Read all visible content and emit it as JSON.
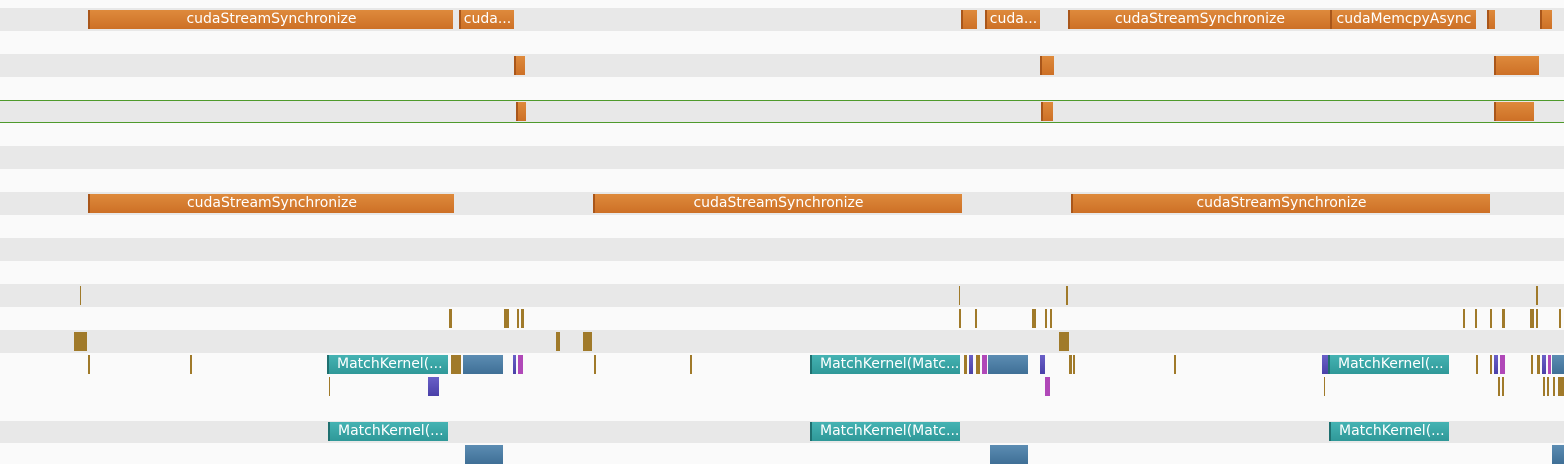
{
  "labels": {
    "sync": "cudaStreamSynchronize",
    "sync_short": "cuda...",
    "memcpy_async": "cudaMemcpyAsync",
    "kernel_short": "MatchKernel(...",
    "kernel_mid": "MatchKernel(Matc..."
  },
  "colors": {
    "api": "#d27830",
    "kernel": "#3aa8a8",
    "memcpy": "#4f80a8",
    "selection": "#4f9a2c",
    "row_alt": "#e8e8e8",
    "background": "#fafafa"
  }
}
